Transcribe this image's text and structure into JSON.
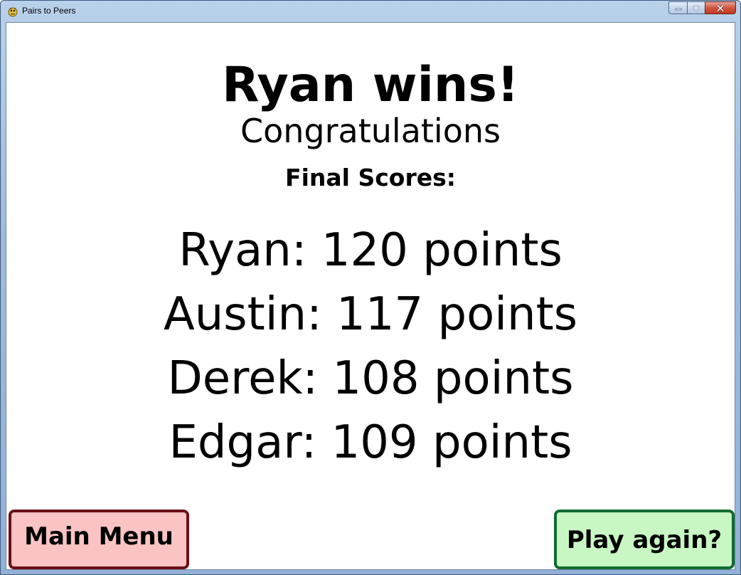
{
  "window": {
    "title": "Pairs to Peers",
    "icon": "pygame-snake-icon",
    "controls": [
      "minimize",
      "maximize",
      "close"
    ]
  },
  "results": {
    "winner_text": "Ryan wins!",
    "subtitle": "Congratulations",
    "scores_heading": "Final Scores:",
    "scores": [
      {
        "text": "Ryan: 120 points",
        "name": "Ryan",
        "points": 120
      },
      {
        "text": "Austin: 117 points",
        "name": "Austin",
        "points": 117
      },
      {
        "text": "Derek: 108 points",
        "name": "Derek",
        "points": 108
      },
      {
        "text": "Edgar: 109 points",
        "name": "Edgar",
        "points": 109
      }
    ]
  },
  "buttons": {
    "main_menu": "Main Menu",
    "play_again": "Play again?"
  },
  "colors": {
    "main_menu_fill": "#fbc4c4",
    "main_menu_border": "#6b0f16",
    "play_again_fill": "#c8f7c4",
    "play_again_border": "#0f6b2c"
  }
}
